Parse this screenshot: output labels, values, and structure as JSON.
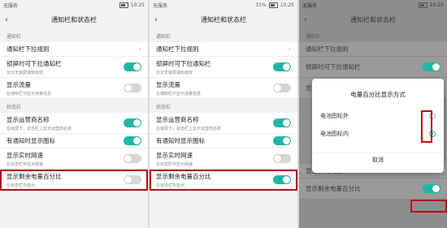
{
  "status": {
    "carrier": "无服务",
    "battery_1": "",
    "battery_2": "31%",
    "battery_3": "",
    "time": "10:25"
  },
  "titles": {
    "title": "通知栏和状态栏"
  },
  "sections": {
    "notify": "通知栏",
    "status": "状态栏"
  },
  "rows": {
    "pull_rule": "通知栏下拉规则",
    "lock_pull": "锁屏时可下拉通知栏",
    "lock_pull_sub": "仅对无锁屏通知有效",
    "show_flow": "显示流量",
    "show_flow_sub": "在通知栏中显示流量信息",
    "carrier_name": "显示运营商名称",
    "carrier_name_sub": "在锁屏下，状态栏上显示运营商名称",
    "notify_icon": "有通知时显示图标",
    "net_speed": "显示实时网速",
    "net_speed_sub": "在状态栏中显示网速",
    "battery_pct": "显示剩余电量百分比",
    "battery_pct_sub": "在状态栏中显示"
  },
  "panel3": {
    "carrier_name_partial": "显示运营商名称",
    "net_speed_partial": "显示实时网速",
    "battery_pct_partial": "显示剩余电量百分比"
  },
  "dialog": {
    "title": "电量百分比显示方式",
    "opt_outside": "电池图标外",
    "opt_inside": "电池图标内",
    "cancel": "取消"
  }
}
